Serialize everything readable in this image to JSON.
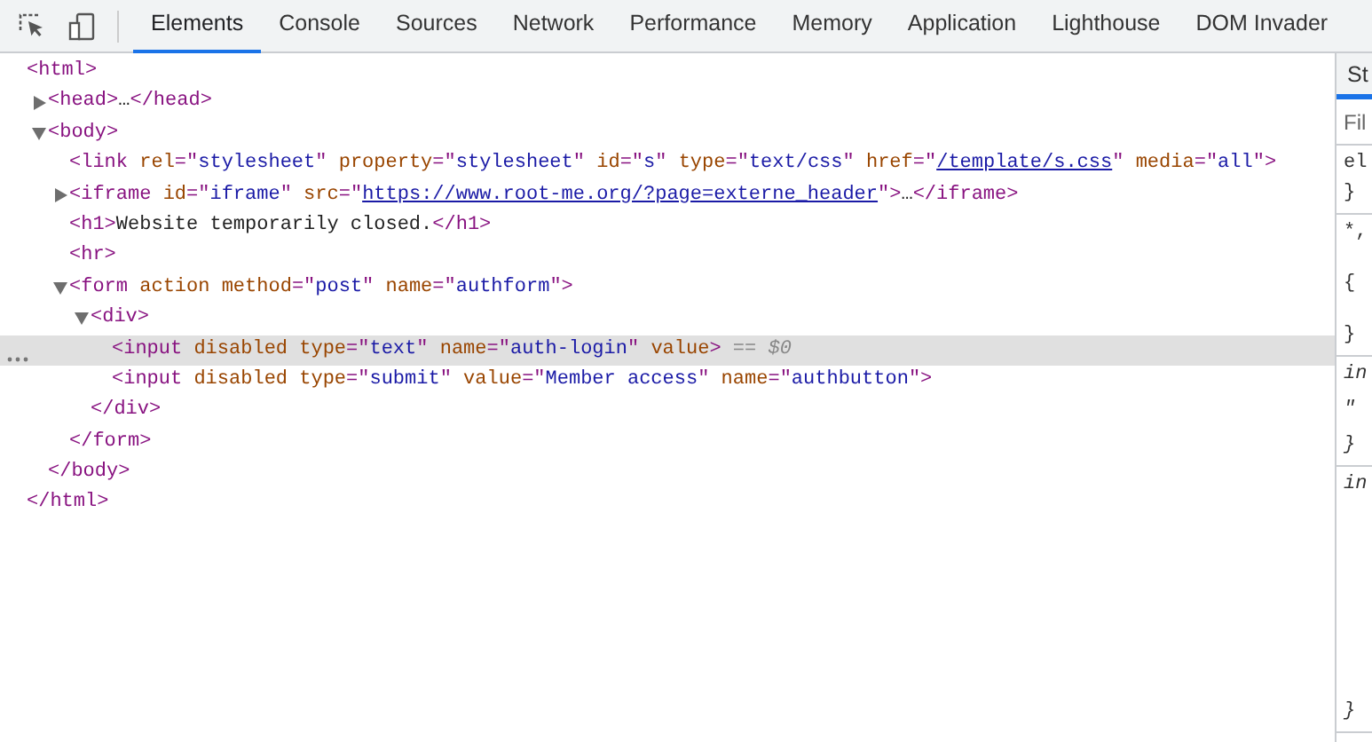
{
  "toolbar": {
    "tabs": [
      {
        "label": "Elements",
        "selected": true
      },
      {
        "label": "Console",
        "selected": false
      },
      {
        "label": "Sources",
        "selected": false
      },
      {
        "label": "Network",
        "selected": false
      },
      {
        "label": "Performance",
        "selected": false
      },
      {
        "label": "Memory",
        "selected": false
      },
      {
        "label": "Application",
        "selected": false
      },
      {
        "label": "Lighthouse",
        "selected": false
      },
      {
        "label": "DOM Invader",
        "selected": false
      }
    ]
  },
  "dom_tree": [
    {
      "selected": false,
      "open": [
        {
          "kind": "tag",
          "text": "<html>"
        }
      ],
      "close": [
        {
          "kind": "tag",
          "text": "</html>"
        }
      ],
      "children": [
        {
          "selected": false,
          "expanded": false,
          "open": [
            {
              "kind": "tag",
              "text": "<head>"
            },
            {
              "kind": "text",
              "text": "…"
            },
            {
              "kind": "tag",
              "text": "</head>"
            }
          ]
        },
        {
          "selected": false,
          "expanded": true,
          "open": [
            {
              "kind": "tag",
              "text": "<body>"
            }
          ],
          "close": [
            {
              "kind": "tag",
              "text": "</body>"
            }
          ],
          "children": [
            {
              "selected": false,
              "open": [
                {
                  "kind": "tag",
                  "text": "<link"
                },
                {
                  "kind": "attr",
                  "text": " rel"
                },
                {
                  "kind": "tag",
                  "text": "=\""
                },
                {
                  "kind": "value",
                  "text": "stylesheet"
                },
                {
                  "kind": "tag",
                  "text": "\""
                },
                {
                  "kind": "attr",
                  "text": " property"
                },
                {
                  "kind": "tag",
                  "text": "=\""
                },
                {
                  "kind": "value",
                  "text": "stylesheet"
                },
                {
                  "kind": "tag",
                  "text": "\""
                },
                {
                  "kind": "attr",
                  "text": " id"
                },
                {
                  "kind": "tag",
                  "text": "=\""
                },
                {
                  "kind": "value",
                  "text": "s"
                },
                {
                  "kind": "tag",
                  "text": "\""
                },
                {
                  "kind": "attr",
                  "text": " type"
                },
                {
                  "kind": "tag",
                  "text": "=\""
                },
                {
                  "kind": "value",
                  "text": "text/css"
                },
                {
                  "kind": "tag",
                  "text": "\""
                },
                {
                  "kind": "attr",
                  "text": " href"
                },
                {
                  "kind": "tag",
                  "text": "=\""
                },
                {
                  "kind": "link",
                  "text": "/template/s.css"
                },
                {
                  "kind": "tag",
                  "text": "\""
                },
                {
                  "kind": "attr",
                  "text": " media"
                },
                {
                  "kind": "tag",
                  "text": "=\""
                },
                {
                  "kind": "value",
                  "text": "all"
                },
                {
                  "kind": "tag",
                  "text": "\">"
                }
              ]
            },
            {
              "selected": false,
              "expanded": false,
              "open": [
                {
                  "kind": "tag",
                  "text": "<iframe"
                },
                {
                  "kind": "attr",
                  "text": " id"
                },
                {
                  "kind": "tag",
                  "text": "=\""
                },
                {
                  "kind": "value",
                  "text": "iframe"
                },
                {
                  "kind": "tag",
                  "text": "\""
                },
                {
                  "kind": "attr",
                  "text": " src"
                },
                {
                  "kind": "tag",
                  "text": "=\""
                },
                {
                  "kind": "link",
                  "text": "https://www.root-me.org/?page=externe_header"
                },
                {
                  "kind": "tag",
                  "text": "\">"
                },
                {
                  "kind": "text",
                  "text": "…"
                },
                {
                  "kind": "tag",
                  "text": "</iframe>"
                }
              ]
            },
            {
              "selected": false,
              "open": [
                {
                  "kind": "tag",
                  "text": "<h1>"
                },
                {
                  "kind": "text",
                  "text": "Website temporarily closed."
                },
                {
                  "kind": "tag",
                  "text": "</h1>"
                }
              ]
            },
            {
              "selected": false,
              "open": [
                {
                  "kind": "tag",
                  "text": "<hr>"
                }
              ]
            },
            {
              "selected": false,
              "expanded": true,
              "open": [
                {
                  "kind": "tag",
                  "text": "<form"
                },
                {
                  "kind": "attr",
                  "text": " action method"
                },
                {
                  "kind": "tag",
                  "text": "=\""
                },
                {
                  "kind": "value",
                  "text": "post"
                },
                {
                  "kind": "tag",
                  "text": "\""
                },
                {
                  "kind": "attr",
                  "text": " name"
                },
                {
                  "kind": "tag",
                  "text": "=\""
                },
                {
                  "kind": "value",
                  "text": "authform"
                },
                {
                  "kind": "tag",
                  "text": "\">"
                }
              ],
              "close": [
                {
                  "kind": "tag",
                  "text": "</form>"
                }
              ],
              "children": [
                {
                  "selected": false,
                  "expanded": true,
                  "open": [
                    {
                      "kind": "tag",
                      "text": "<div>"
                    }
                  ],
                  "close": [
                    {
                      "kind": "tag",
                      "text": "</div>"
                    }
                  ],
                  "children": [
                    {
                      "selected": true,
                      "open": [
                        {
                          "kind": "tag",
                          "text": "<input"
                        },
                        {
                          "kind": "attr",
                          "text": " disabled type"
                        },
                        {
                          "kind": "tag",
                          "text": "=\""
                        },
                        {
                          "kind": "value",
                          "text": "text"
                        },
                        {
                          "kind": "tag",
                          "text": "\""
                        },
                        {
                          "kind": "attr",
                          "text": " name"
                        },
                        {
                          "kind": "tag",
                          "text": "=\""
                        },
                        {
                          "kind": "value",
                          "text": "auth-login"
                        },
                        {
                          "kind": "tag",
                          "text": "\""
                        },
                        {
                          "kind": "attr",
                          "text": " value"
                        },
                        {
                          "kind": "tag",
                          "text": ">"
                        },
                        {
                          "kind": "console",
                          "text": " == $0"
                        }
                      ]
                    },
                    {
                      "selected": false,
                      "open": [
                        {
                          "kind": "tag",
                          "text": "<input"
                        },
                        {
                          "kind": "attr",
                          "text": " disabled type"
                        },
                        {
                          "kind": "tag",
                          "text": "=\""
                        },
                        {
                          "kind": "value",
                          "text": "submit"
                        },
                        {
                          "kind": "tag",
                          "text": "\""
                        },
                        {
                          "kind": "attr",
                          "text": " value"
                        },
                        {
                          "kind": "tag",
                          "text": "=\""
                        },
                        {
                          "kind": "value",
                          "text": "Member access"
                        },
                        {
                          "kind": "tag",
                          "text": "\""
                        },
                        {
                          "kind": "attr",
                          "text": " name"
                        },
                        {
                          "kind": "tag",
                          "text": "=\""
                        },
                        {
                          "kind": "value",
                          "text": "authbutton"
                        },
                        {
                          "kind": "tag",
                          "text": "\">"
                        }
                      ]
                    }
                  ]
                }
              ]
            }
          ]
        }
      ]
    }
  ],
  "styles_pane": {
    "tab": {
      "label": "St",
      "selected": true
    },
    "filter": {
      "placeholder": "Fil"
    },
    "rules": [
      {
        "italic": false,
        "lines": [
          "el",
          "}"
        ]
      },
      {
        "italic": false,
        "lines": [
          "*,",
          "{",
          "}"
        ]
      },
      {
        "italic": true,
        "lines": [
          "in",
          "\"",
          "}"
        ]
      },
      {
        "italic": true,
        "lines": [
          "in",
          "}"
        ]
      }
    ]
  }
}
